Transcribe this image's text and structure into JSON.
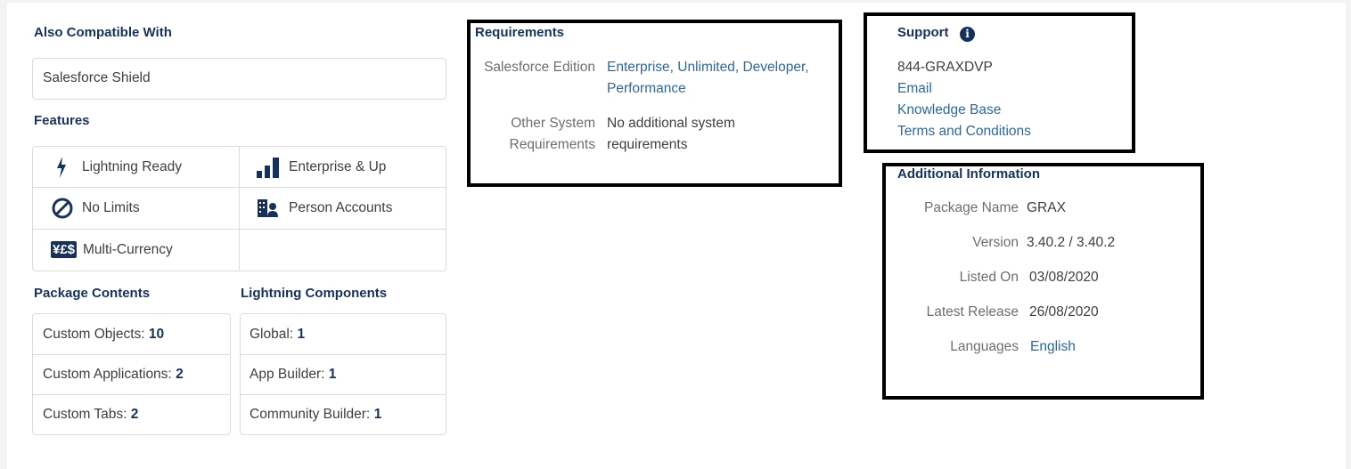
{
  "also_compatible": {
    "heading": "Also Compatible With",
    "items": [
      "Salesforce Shield"
    ]
  },
  "features": {
    "heading": "Features",
    "items": [
      {
        "label": "Lightning Ready",
        "icon": "lightning-icon"
      },
      {
        "label": "Enterprise & Up",
        "icon": "bar-chart-icon"
      },
      {
        "label": "No Limits",
        "icon": "no-limit-icon"
      },
      {
        "label": "Person Accounts",
        "icon": "person-accounts-icon"
      },
      {
        "label": "Multi-Currency",
        "icon": "currency-icon",
        "icon_text": "¥£$"
      }
    ]
  },
  "package_contents": {
    "heading": "Package Contents",
    "rows": [
      {
        "label": "Custom Objects:",
        "value": "10"
      },
      {
        "label": "Custom Applications:",
        "value": "2"
      },
      {
        "label": "Custom Tabs:",
        "value": "2"
      }
    ]
  },
  "lightning_components": {
    "heading": "Lightning Components",
    "rows": [
      {
        "label": "Global:",
        "value": "1"
      },
      {
        "label": "App Builder:",
        "value": "1"
      },
      {
        "label": "Community Builder:",
        "value": "1"
      }
    ]
  },
  "requirements": {
    "heading": "Requirements",
    "salesforce_edition_label": "Salesforce Edition",
    "salesforce_edition_line1": "Enterprise, Unlimited, Developer,",
    "salesforce_edition_line2": "Performance",
    "other_label_line1": "Other System",
    "other_label_line2": "Requirements",
    "other_value_line1": "No additional system",
    "other_value_line2": "requirements"
  },
  "support": {
    "heading": "Support",
    "phone": "844-GRAXDVP",
    "links": [
      "Email",
      "Knowledge Base",
      "Terms and Conditions"
    ]
  },
  "additional_info": {
    "heading": "Additional Information",
    "rows": [
      {
        "label": "Package Name",
        "value": "GRAX"
      },
      {
        "label": "Version",
        "value": "3.40.2 / 3.40.2"
      },
      {
        "label": "Listed On",
        "value": "03/08/2020"
      },
      {
        "label": "Latest Release",
        "value": "26/08/2020"
      },
      {
        "label": "Languages",
        "value": "English"
      }
    ]
  },
  "colors": {
    "heading": "#16325c",
    "link": "#2a6aa1",
    "border": "#dddbda",
    "highlight": "#000000"
  }
}
